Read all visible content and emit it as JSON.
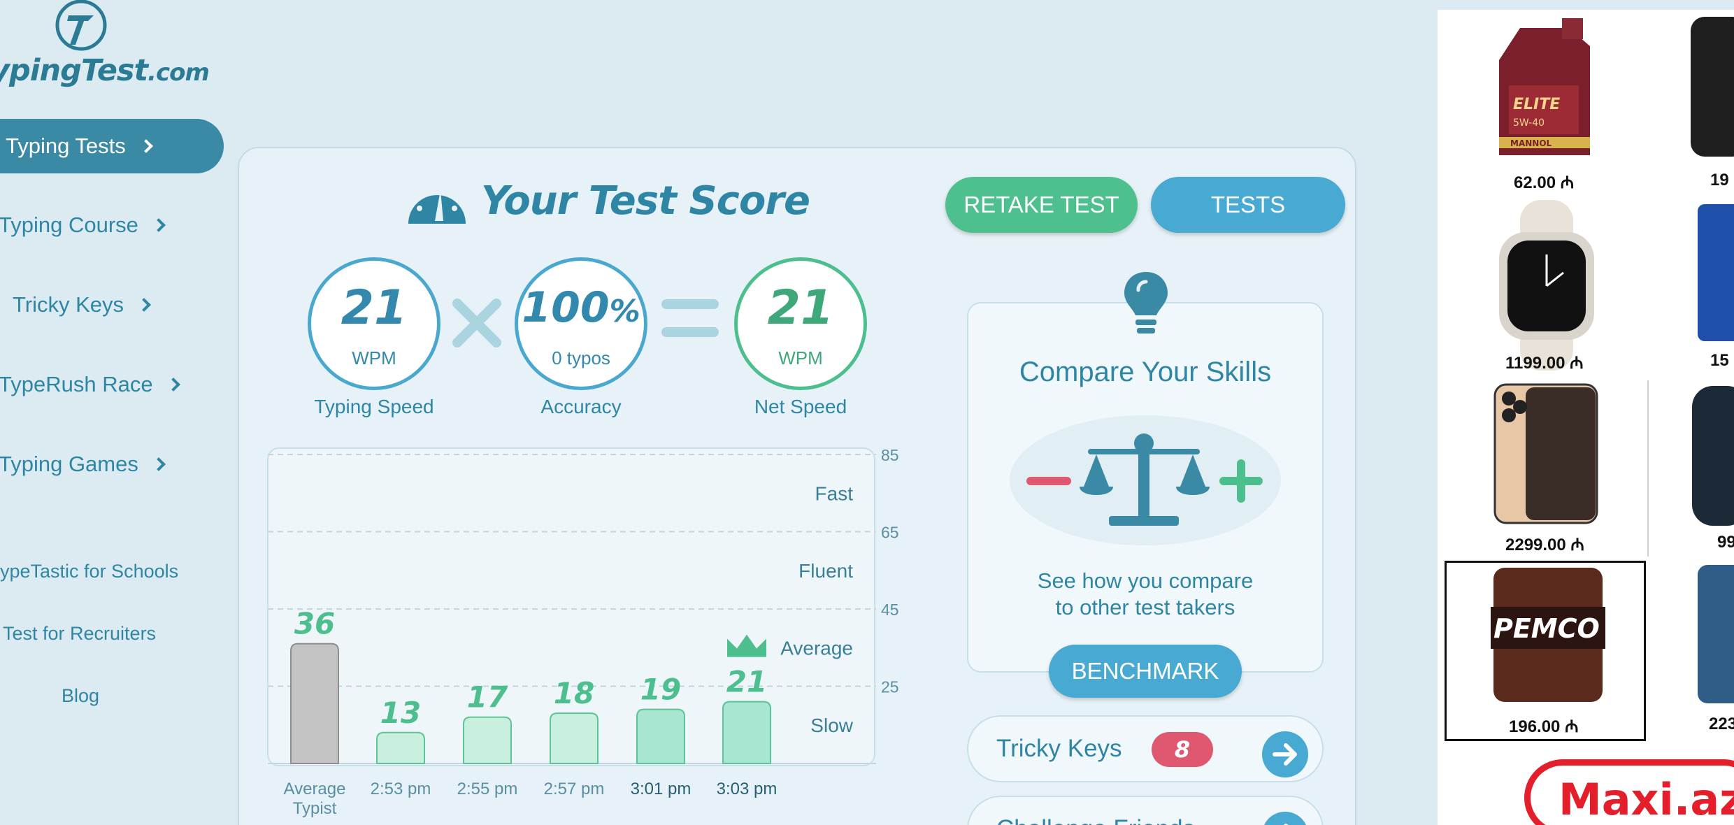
{
  "brand": {
    "logo_text": "ypingTest",
    "logo_suffix": ".com"
  },
  "nav": {
    "active": "Typing Tests",
    "items": [
      "Typing Course",
      "Tricky Keys",
      "TypeRush Race",
      "Typing Games"
    ],
    "links": [
      "ypeTastic for Schools",
      "Test for Recruiters",
      "Blog"
    ]
  },
  "score": {
    "title": "Your Test Score",
    "speed": {
      "value": "21",
      "unit": "WPM",
      "label": "Typing Speed"
    },
    "accuracy": {
      "value": "100",
      "pct": "%",
      "sub": "0  typos",
      "label": "Accuracy"
    },
    "net": {
      "value": "21",
      "unit": "WPM",
      "label": "Net Speed"
    }
  },
  "buttons": {
    "retake": "RETAKE TEST",
    "tests": "TESTS",
    "benchmark": "BENCHMARK"
  },
  "compare": {
    "title": "Compare Your Skills",
    "subtitle_1": "See how you compare",
    "subtitle_2": "to other test takers"
  },
  "rows": {
    "tricky_label": "Tricky Keys",
    "tricky_count": "8",
    "challenge_label": "Challenge Friends"
  },
  "chart_data": {
    "type": "bar",
    "categories": [
      "Average\nTypist",
      "2:53 pm",
      "2:55 pm",
      "2:57 pm",
      "3:01 pm",
      "3:03 pm"
    ],
    "values": [
      36,
      13,
      17,
      18,
      19,
      21
    ],
    "ylim": [
      5,
      85
    ],
    "yticks": [
      85,
      65,
      45,
      25
    ],
    "zones": [
      "Fast",
      "Fluent",
      "Average",
      "Slow"
    ],
    "highlight_index": 5,
    "colors": {
      "average": "#c4c4c4",
      "bar": "#c9efdf",
      "bar_recent": "#a9e6d2",
      "label": "#4dbf8f"
    }
  },
  "ad": {
    "products": [
      {
        "name": "ELITE",
        "price": "62.00 ₼"
      },
      {
        "name": "",
        "price": "1199.00 ₼"
      },
      {
        "name": "",
        "price": "2299.00 ₼"
      },
      {
        "name": "PEMCO",
        "price": "196.00 ₼"
      }
    ],
    "side_prices": [
      "19",
      "15",
      "99",
      "223"
    ],
    "oil_label": "5W-40",
    "oil_brand": "MANNOL",
    "brand": "Maxi.az"
  }
}
